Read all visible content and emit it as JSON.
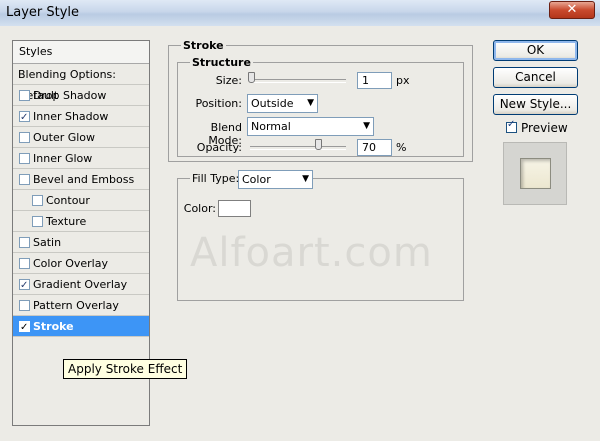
{
  "window": {
    "title": "Layer Style",
    "close_icon": "close-icon"
  },
  "styles_panel": {
    "header": "Styles",
    "items": [
      {
        "label": "Blending Options: Default",
        "checkbox": false,
        "checked": false,
        "indent": false,
        "selected": false
      },
      {
        "label": "Drop Shadow",
        "checkbox": true,
        "checked": false,
        "indent": false,
        "selected": false
      },
      {
        "label": "Inner Shadow",
        "checkbox": true,
        "checked": true,
        "indent": false,
        "selected": false
      },
      {
        "label": "Outer Glow",
        "checkbox": true,
        "checked": false,
        "indent": false,
        "selected": false
      },
      {
        "label": "Inner Glow",
        "checkbox": true,
        "checked": false,
        "indent": false,
        "selected": false
      },
      {
        "label": "Bevel and Emboss",
        "checkbox": true,
        "checked": false,
        "indent": false,
        "selected": false
      },
      {
        "label": "Contour",
        "checkbox": true,
        "checked": false,
        "indent": true,
        "selected": false
      },
      {
        "label": "Texture",
        "checkbox": true,
        "checked": false,
        "indent": true,
        "selected": false
      },
      {
        "label": "Satin",
        "checkbox": true,
        "checked": false,
        "indent": false,
        "selected": false
      },
      {
        "label": "Color Overlay",
        "checkbox": true,
        "checked": false,
        "indent": false,
        "selected": false
      },
      {
        "label": "Gradient Overlay",
        "checkbox": true,
        "checked": true,
        "indent": false,
        "selected": false
      },
      {
        "label": "Pattern Overlay",
        "checkbox": true,
        "checked": false,
        "indent": false,
        "selected": false
      },
      {
        "label": "Stroke",
        "checkbox": true,
        "checked": true,
        "indent": false,
        "selected": true
      }
    ],
    "tooltip": "Apply Stroke Effect"
  },
  "stroke": {
    "title": "Stroke",
    "structure": {
      "title": "Structure",
      "size_label": "Size:",
      "size_value": "1",
      "size_unit": "px",
      "position_label": "Position:",
      "position_value": "Outside",
      "blend_mode_label": "Blend Mode:",
      "blend_mode_value": "Normal",
      "opacity_label": "Opacity:",
      "opacity_value": "70",
      "opacity_unit": "%"
    },
    "fill": {
      "fill_type_label": "Fill Type:",
      "fill_type_value": "Color",
      "color_label": "Color:",
      "color_value": "#ffffff"
    }
  },
  "watermark": "Alfoart.com",
  "buttons": {
    "ok": "OK",
    "cancel": "Cancel",
    "new_style": "New Style...",
    "preview_label": "Preview",
    "preview_checked": true
  },
  "colors": {
    "selection": "#3d95f6",
    "dialog_bg": "#ecebe6"
  }
}
